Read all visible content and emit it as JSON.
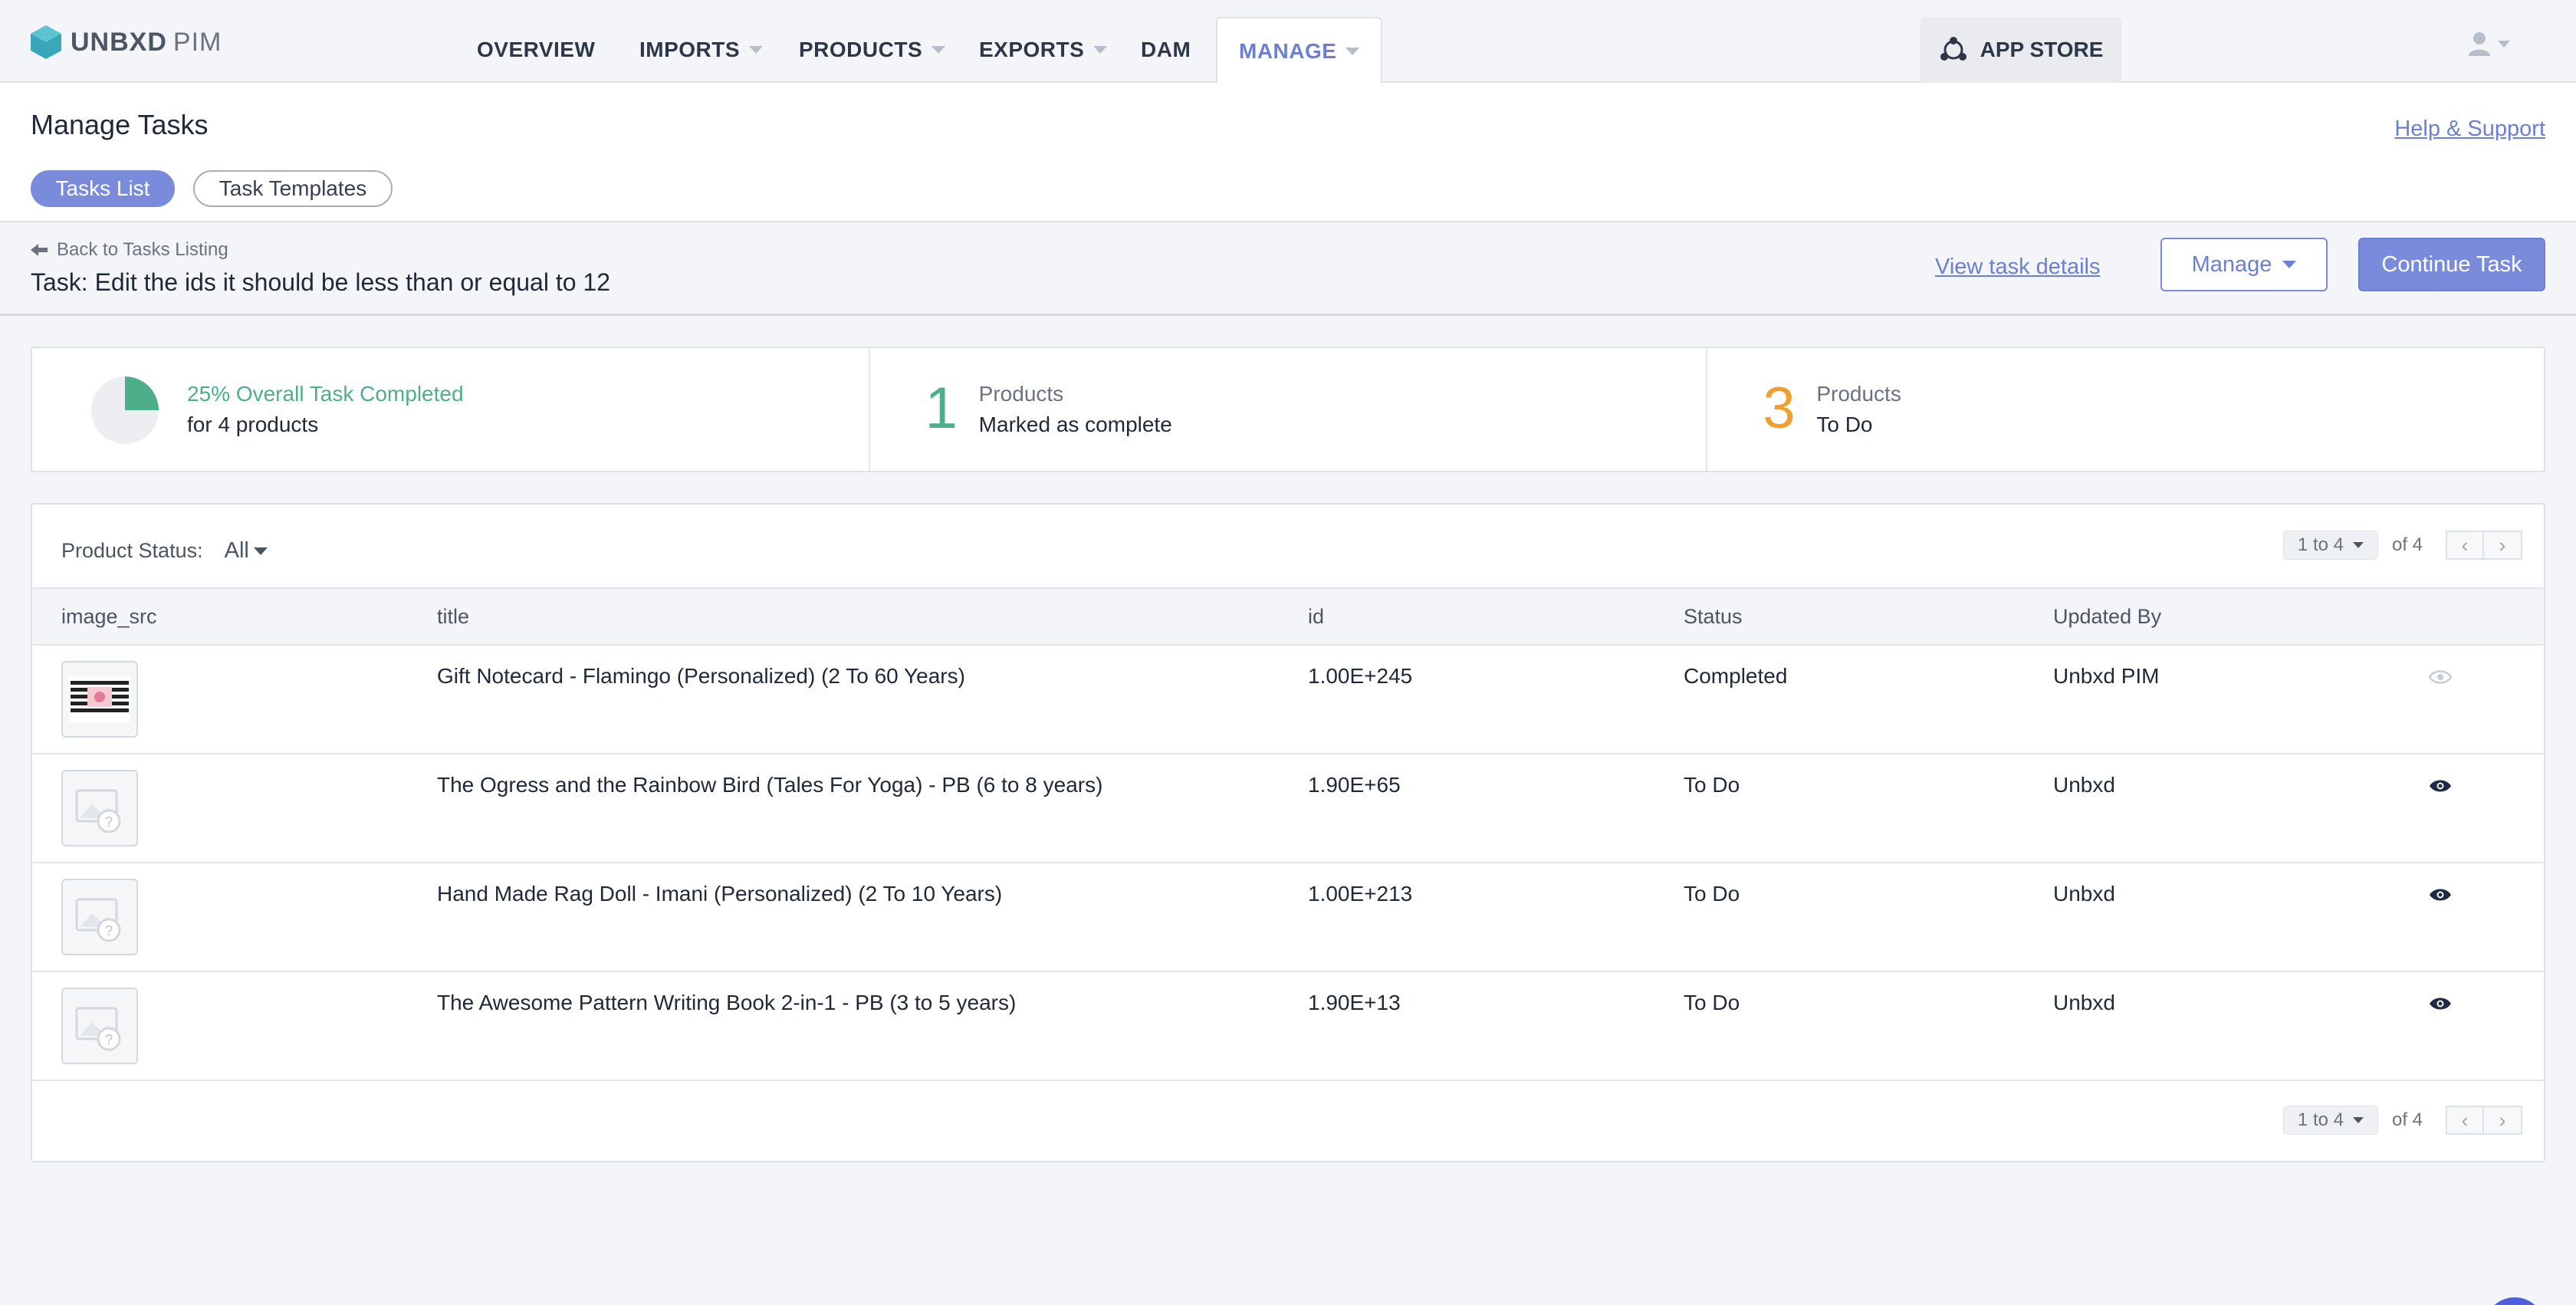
{
  "brand": {
    "name": "UNBXD",
    "suffix": "PIM"
  },
  "nav": {
    "items": [
      {
        "label": "OVERVIEW",
        "caret": false
      },
      {
        "label": "IMPORTS",
        "caret": true
      },
      {
        "label": "PRODUCTS",
        "caret": true
      },
      {
        "label": "EXPORTS",
        "caret": true
      },
      {
        "label": "DAM",
        "caret": false
      },
      {
        "label": "MANAGE",
        "caret": true,
        "active": true
      }
    ],
    "app_store": "APP STORE"
  },
  "page": {
    "title": "Manage Tasks",
    "help": "Help & Support",
    "tabs": [
      {
        "label": "Tasks List",
        "active": true
      },
      {
        "label": "Task Templates",
        "active": false
      }
    ]
  },
  "task": {
    "back": "Back to Tasks Listing",
    "name": "Task: Edit the ids it should be less than or equal to 12",
    "view_details": "View task details",
    "manage": "Manage",
    "continue": "Continue Task"
  },
  "stats": {
    "completion": {
      "fraction": 0.25,
      "headline": "25% Overall Task Completed",
      "sub": "for 4 products"
    },
    "complete": {
      "count": "1",
      "label": "Products",
      "sub": "Marked as complete"
    },
    "todo": {
      "count": "3",
      "label": "Products",
      "sub": "To Do"
    }
  },
  "filter": {
    "label": "Product Status:",
    "value": "All"
  },
  "pager": {
    "range": "1 to 4",
    "of": "of 4"
  },
  "table": {
    "columns": [
      "image_src",
      "title",
      "id",
      "Status",
      "Updated By",
      ""
    ],
    "rows": [
      {
        "image": "notecard-thumbnail",
        "title": "Gift Notecard - Flamingo (Personalized) (2 To 60 Years)",
        "id": "1.00E+245",
        "status": "Completed",
        "updated_by": "Unbxd PIM",
        "eye_active": false
      },
      {
        "image": "placeholder",
        "title": "The Ogress and the Rainbow Bird (Tales For Yoga) - PB (6 to 8 years)",
        "id": "1.90E+65",
        "status": "To Do",
        "updated_by": "Unbxd",
        "eye_active": true
      },
      {
        "image": "placeholder",
        "title": "Hand Made Rag Doll - Imani (Personalized) (2 To 10 Years)",
        "id": "1.00E+213",
        "status": "To Do",
        "updated_by": "Unbxd",
        "eye_active": true
      },
      {
        "image": "placeholder",
        "title": "The Awesome Pattern Writing Book 2-in-1 - PB (3 to 5 years)",
        "id": "1.90E+13",
        "status": "To Do",
        "updated_by": "Unbxd",
        "eye_active": true
      }
    ]
  },
  "colors": {
    "accent": "#7b8bdc",
    "success": "#4caf8a",
    "warning": "#f0a030",
    "eye_active": "#1f2a44",
    "eye_inactive": "#c8ccd3"
  }
}
